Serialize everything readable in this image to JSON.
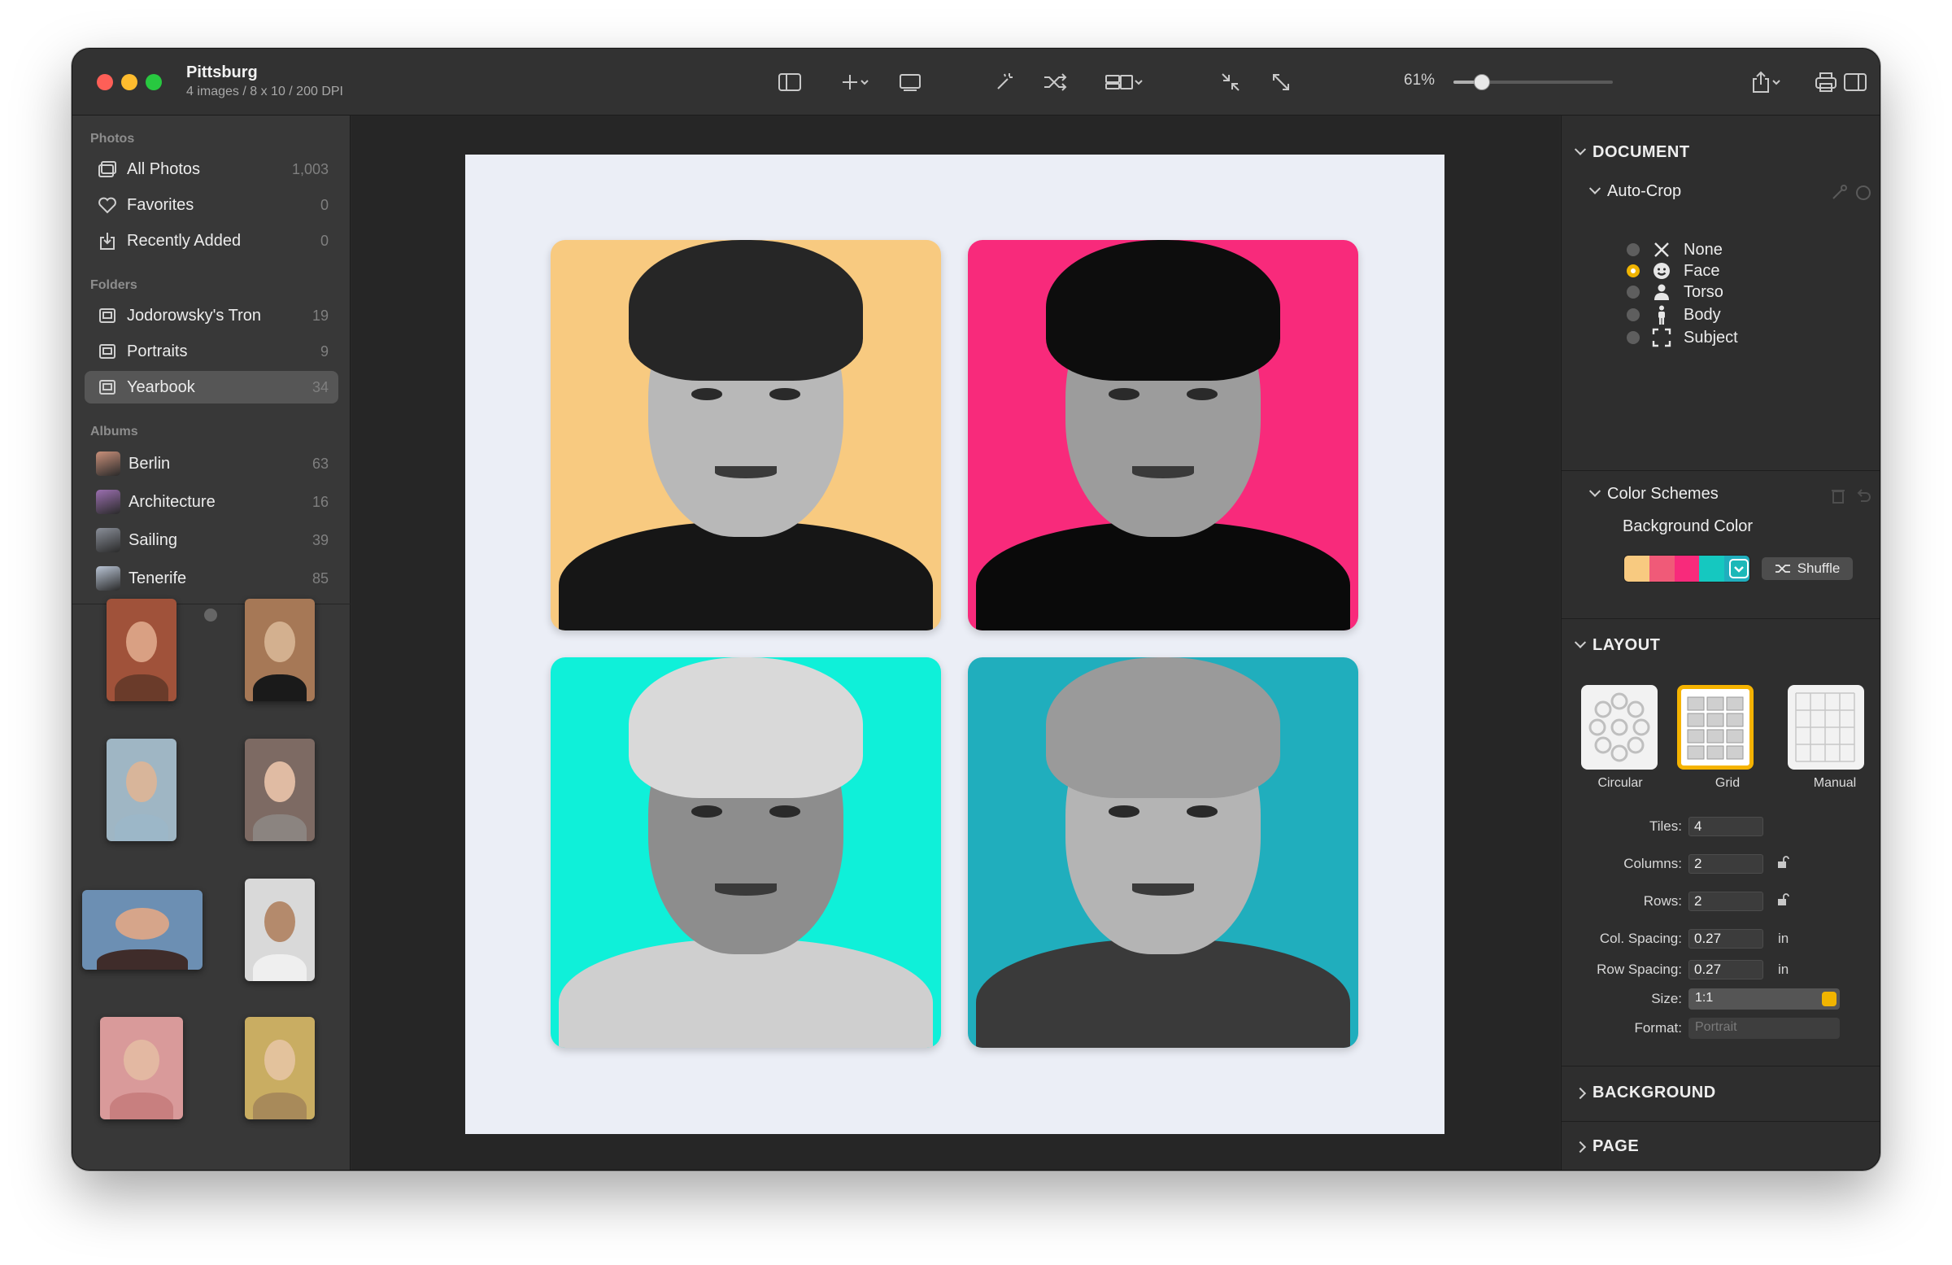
{
  "window": {
    "title": "Pittsburg",
    "subtitle": "4 images / 8 x 10 / 200 DPI"
  },
  "toolbar": {
    "zoom_label": "61%",
    "zoom_value": 0.18,
    "icons": [
      "sidebar-toggle-icon",
      "add-icon",
      "chevron-down-icon",
      "slideshow-icon",
      "magic-wand-icon",
      "shuffle-icon",
      "layout-icon",
      "chevron-down-icon",
      "shrink-icon",
      "expand-icon",
      "share-icon",
      "chevron-down-icon",
      "print-icon",
      "inspector-toggle-icon"
    ]
  },
  "sidebar": {
    "photos_title": "Photos",
    "photos": [
      {
        "label": "All Photos",
        "count": "1,003",
        "icon": "photos-icon"
      },
      {
        "label": "Favorites",
        "count": "0",
        "icon": "heart-icon"
      },
      {
        "label": "Recently Added",
        "count": "0",
        "icon": "import-icon"
      }
    ],
    "folders_title": "Folders",
    "folders": [
      {
        "label": "Jodorowsky's Tron",
        "count": "19",
        "icon": "folder-icon"
      },
      {
        "label": "Portraits",
        "count": "9",
        "icon": "folder-icon"
      },
      {
        "label": "Yearbook",
        "count": "34",
        "icon": "folder-icon",
        "selected": true
      }
    ],
    "albums_title": "Albums",
    "albums": [
      {
        "label": "Berlin",
        "count": "63",
        "color": "#c9907a"
      },
      {
        "label": "Architecture",
        "count": "16",
        "color": "#9b6fb0"
      },
      {
        "label": "Sailing",
        "count": "39",
        "color": "#8a8f99"
      },
      {
        "label": "Tenerife",
        "count": "85",
        "color": "#b9c4d4"
      }
    ],
    "thumbnails": [
      {
        "bg": "#a0523a",
        "skin": "#d9a083",
        "shirt": "#6a3b2a"
      },
      {
        "bg": "#a67856",
        "skin": "#d3b08f",
        "shirt": "#1a1a1a"
      },
      {
        "bg": "#9fb6c4",
        "skin": "#d8b59a",
        "shirt": "#9cb7c8"
      },
      {
        "bg": "#7d6a63",
        "skin": "#e0bba3",
        "shirt": "#8b8480"
      },
      {
        "bg": "#6c8fb3",
        "skin": "#d6a58a",
        "shirt": "#3f2c2a"
      },
      {
        "bg": "#d9d9d9",
        "skin": "#b48a6c",
        "shirt": "#efefef"
      },
      {
        "bg": "#d99a9a",
        "skin": "#e3b8a2",
        "shirt": "#c87f7f"
      },
      {
        "bg": "#c9ad62",
        "skin": "#e3c29c",
        "shirt": "#a88a5a"
      }
    ]
  },
  "canvas": {
    "tiles": [
      {
        "bg": "#f8ca80",
        "head": "#b8b8b8",
        "hair": "#262626",
        "body": "#161616"
      },
      {
        "bg": "#f82a7b",
        "head": "#9c9c9c",
        "hair": "#0d0d0d",
        "body": "#0a0a0a"
      },
      {
        "bg": "#0ff0d9",
        "head": "#8d8d8d",
        "hair": "#d9d9d9",
        "body": "#cfcfcf"
      },
      {
        "bg": "#20aebd",
        "head": "#b4b4b4",
        "hair": "#9a9a9a",
        "body": "#3a3a3a"
      }
    ]
  },
  "inspector": {
    "document_title": "DOCUMENT",
    "autocrop_title": "Auto-Crop",
    "autocrop_options": [
      {
        "label": "None",
        "icon": "x-icon",
        "selected": false
      },
      {
        "label": "Face",
        "icon": "face-icon",
        "selected": true
      },
      {
        "label": "Torso",
        "icon": "torso-icon",
        "selected": false
      },
      {
        "label": "Body",
        "icon": "body-icon",
        "selected": false
      },
      {
        "label": "Subject",
        "icon": "subject-icon",
        "selected": false
      }
    ],
    "color_schemes_title": "Color Schemes",
    "background_color_label": "Background Color",
    "swatches": [
      "#f8ca80",
      "#f05a78",
      "#f82a7b",
      "#15c8c0",
      "#20aebd"
    ],
    "shuffle_label": "Shuffle",
    "layout_title": "LAYOUT",
    "layout_options": [
      {
        "label": "Circular",
        "selected": false
      },
      {
        "label": "Grid",
        "selected": true
      },
      {
        "label": "Manual",
        "selected": false
      }
    ],
    "fields": {
      "tiles_label": "Tiles:",
      "tiles_value": "4",
      "columns_label": "Columns:",
      "columns_value": "2",
      "rows_label": "Rows:",
      "rows_value": "2",
      "col_spacing_label": "Col. Spacing:",
      "col_spacing_value": "0.27",
      "col_spacing_unit": "in",
      "row_spacing_label": "Row Spacing:",
      "row_spacing_value": "0.27",
      "row_spacing_unit": "in",
      "size_label": "Size:",
      "size_value": "1:1",
      "format_label": "Format:",
      "format_value": "Portrait"
    },
    "background_title": "BACKGROUND",
    "page_title": "PAGE"
  }
}
